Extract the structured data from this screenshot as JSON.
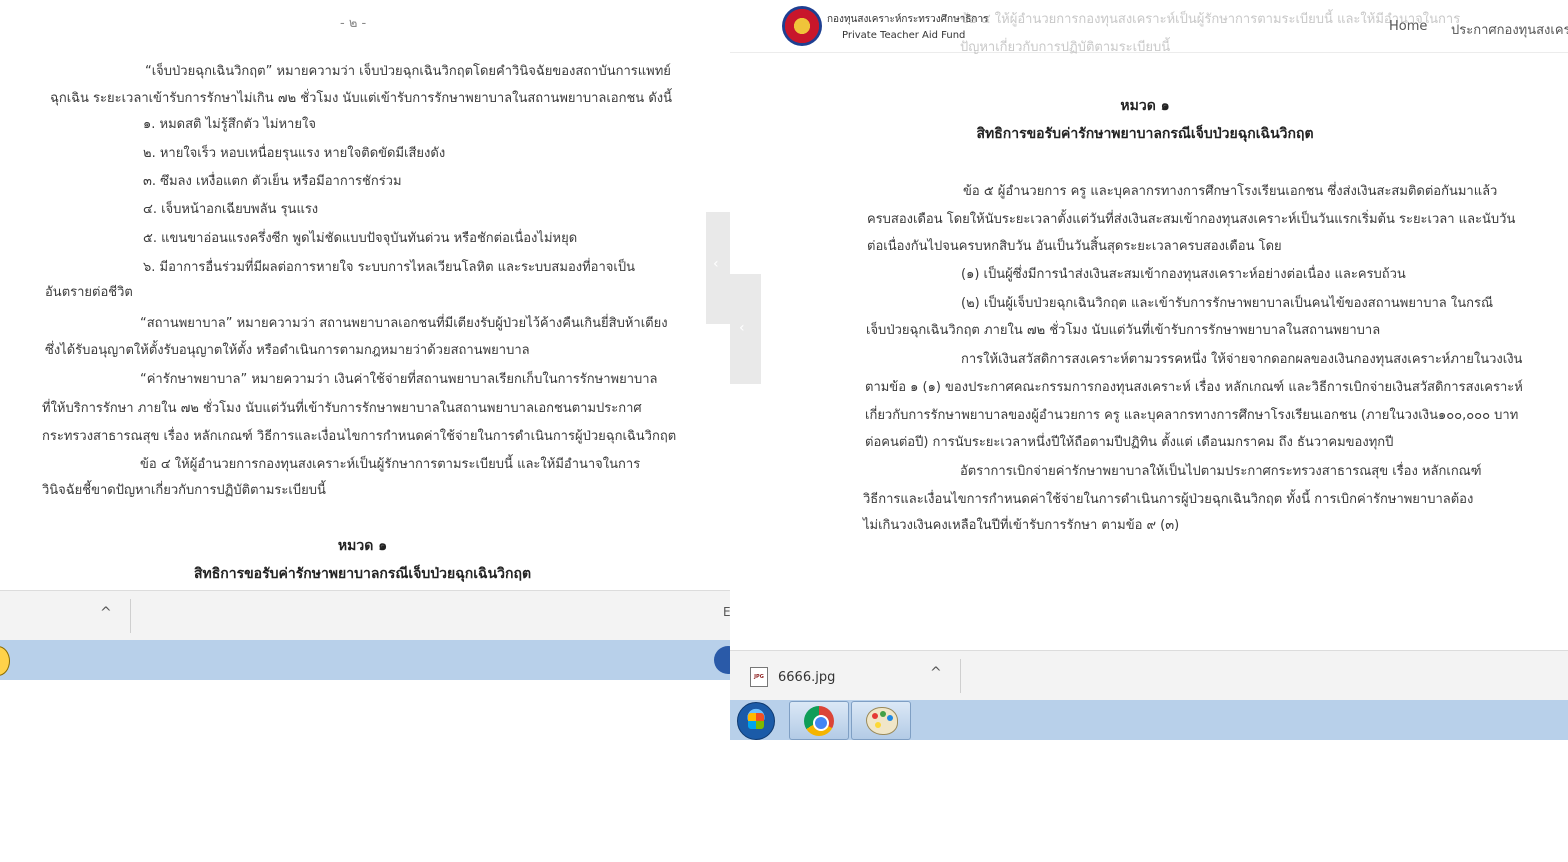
{
  "left": {
    "page_number": "- ๒ -",
    "lines": [
      "“เจ็บป่วยฉุกเฉินวิกฤต” หมายความว่า เจ็บป่วยฉุกเฉินวิกฤตโดยคำวินิจฉัยของสถาบันการแพทย์",
      "ฉุกเฉิน ระยะเวลาเข้ารับการรักษาไม่เกิน ๗๒ ชั่วโมง นับแต่เข้ารับการรักษาพยาบาลในสถานพยาบาลเอกชน ดังนี้",
      "๑. หมดสติ ไม่รู้สึกตัว ไม่หายใจ",
      "๒. หายใจเร็ว หอบเหนื่อยรุนแรง หายใจติดขัดมีเสียงดัง",
      "๓. ซึมลง เหงื่อแตก ตัวเย็น หรือมีอาการชักร่วม",
      "๔. เจ็บหน้าอกเฉียบพลัน รุนแรง",
      "๕. แขนขาอ่อนแรงครึ่งซีก พูดไม่ชัดแบบปัจจุบันทันด่วน หรือชักต่อเนื่องไม่หยุด",
      "๖. มีอาการอื่นร่วมที่มีผลต่อการหายใจ ระบบการไหลเวียนโลหิต และระบบสมองที่อาจเป็น",
      "อันตรายต่อชีวิต",
      "“สถานพยาบาล” หมายความว่า สถานพยาบาลเอกชนที่มีเตียงรับผู้ป่วยไว้ค้างคืนเกินยี่สิบห้าเตียง",
      "ซึ่งได้รับอนุญาตให้ตั้งรับอนุญาตให้ตั้ง หรือดำเนินการตามกฎหมายว่าด้วยสถานพยาบาล",
      "“ค่ารักษาพยาบาล” หมายความว่า เงินค่าใช้จ่ายที่สถานพยาบาลเรียกเก็บในการรักษาพยาบาล",
      "ที่ให้บริการรักษา ภายใน ๗๒ ชั่วโมง นับแต่วันที่เข้ารับการรักษาพยาบาลในสถานพยาบาลเอกชนตามประกาศ",
      "กระทรวงสาธารณสุข เรื่อง หลักเกณฑ์ วิธีการและเงื่อนไขการกำหนดค่าใช้จ่ายในการดำเนินการผู้ป่วยฉุกเฉินวิกฤต",
      "ข้อ ๔ ให้ผู้อำนวยการกองทุนสงเคราะห์เป็นผู้รักษาการตามระเบียบนี้ และให้มีอำนาจในการ",
      "วินิจฉัยชี้ขาดปัญหาเกี่ยวกับการปฏิบัติตามระเบียบนี้"
    ],
    "chapter": "หมวด ๑",
    "chapter_title": "สิทธิการขอรับค่ารักษาพยาบาลกรณีเจ็บป่วยฉุกเฉินวิกฤต",
    "edge_char": "E"
  },
  "right": {
    "header": {
      "logo_th": "กองทุนสงเคราะห์กระทรวงศึกษาธิการ",
      "logo_en": "Private Teacher Aid Fund",
      "nav_home": "Home",
      "nav_announce": "ประกาศกองทุนสงเคราะห์",
      "ghost_1": "ข้อ ๔ ให้ผู้อำนวยการกองทุนสงเคราะห์เป็นผู้รักษาการตามระเบียบนี้ และให้มีอำนาจในการ",
      "ghost_2": "ปัญหาเกี่ยวกับการปฏิบัติตามระเบียบนี้"
    },
    "chapter": "หมวด ๑",
    "chapter_title": "สิทธิการขอรับค่ารักษาพยาบาลกรณีเจ็บป่วยฉุกเฉินวิกฤต",
    "lines": [
      "ข้อ ๕ ผู้อำนวยการ ครู และบุคลากรทางการศึกษาโรงเรียนเอกชน ซึ่งส่งเงินสะสมติดต่อกันมาแล้ว",
      "ครบสองเดือน โดยให้นับระยะเวลาตั้งแต่วันที่ส่งเงินสะสมเข้ากองทุนสงเคราะห์เป็นวันแรกเริ่มต้น ระยะเวลา และนับวัน",
      "ต่อเนื่องกันไปจนครบหกสิบวัน อันเป็นวันสิ้นสุดระยะเวลาครบสองเดือน โดย",
      "(๑) เป็นผู้ซึ่งมีการนำส่งเงินสะสมเข้ากองทุนสงเคราะห์อย่างต่อเนื่อง และครบถ้วน",
      "(๒) เป็นผู้เจ็บป่วยฉุกเฉินวิกฤต และเข้ารับการรักษาพยาบาลเป็นคนไข้ของสถานพยาบาล ในกรณี",
      "เจ็บป่วยฉุกเฉินวิกฤต ภายใน ๗๒ ชั่วโมง นับแต่วันที่เข้ารับการรักษาพยาบาลในสถานพยาบาล",
      "การให้เงินสวัสดิการสงเคราะห์ตามวรรคหนึ่ง ให้จ่ายจากดอกผลของเงินกองทุนสงเคราะห์ภายในวงเงิน",
      "ตามข้อ ๑ (๑) ของประกาศคณะกรรมการกองทุนสงเคราะห์ เรื่อง หลักเกณฑ์ และวิธีการเบิกจ่ายเงินสวัสดิการสงเคราะห์",
      "เกี่ยวกับการรักษาพยาบาลของผู้อำนวยการ ครู และบุคลากรทางการศึกษาโรงเรียนเอกชน (ภายในวงเงิน๑๐๐,๐๐๐ บาท",
      "ต่อคนต่อปี) การนับระยะเวลาหนึ่งปีให้ถือตามปีปฏิทิน ตั้งแต่ เดือนมกราคม ถึง ธันวาคมของทุกปี",
      "อัตราการเบิกจ่ายค่ารักษาพยาบาลให้เป็นไปตามประกาศกระทรวงสาธารณสุข เรื่อง หลักเกณฑ์",
      "วิธีการและเงื่อนไขการกำหนดค่าใช้จ่ายในการดำเนินการผู้ป่วยฉุกเฉินวิกฤต ทั้งนี้ การเบิกค่ารักษาพยาบาลต้อง",
      "ไม่เกินวงเงินคงเหลือในปีที่เข้ารับการรักษา ตามข้อ ๙ (๓)"
    ],
    "download": {
      "icon_label": "JPG",
      "filename": "6666.jpg"
    }
  },
  "icons": {
    "chevron_left": "‹",
    "chevron_up": "^"
  }
}
